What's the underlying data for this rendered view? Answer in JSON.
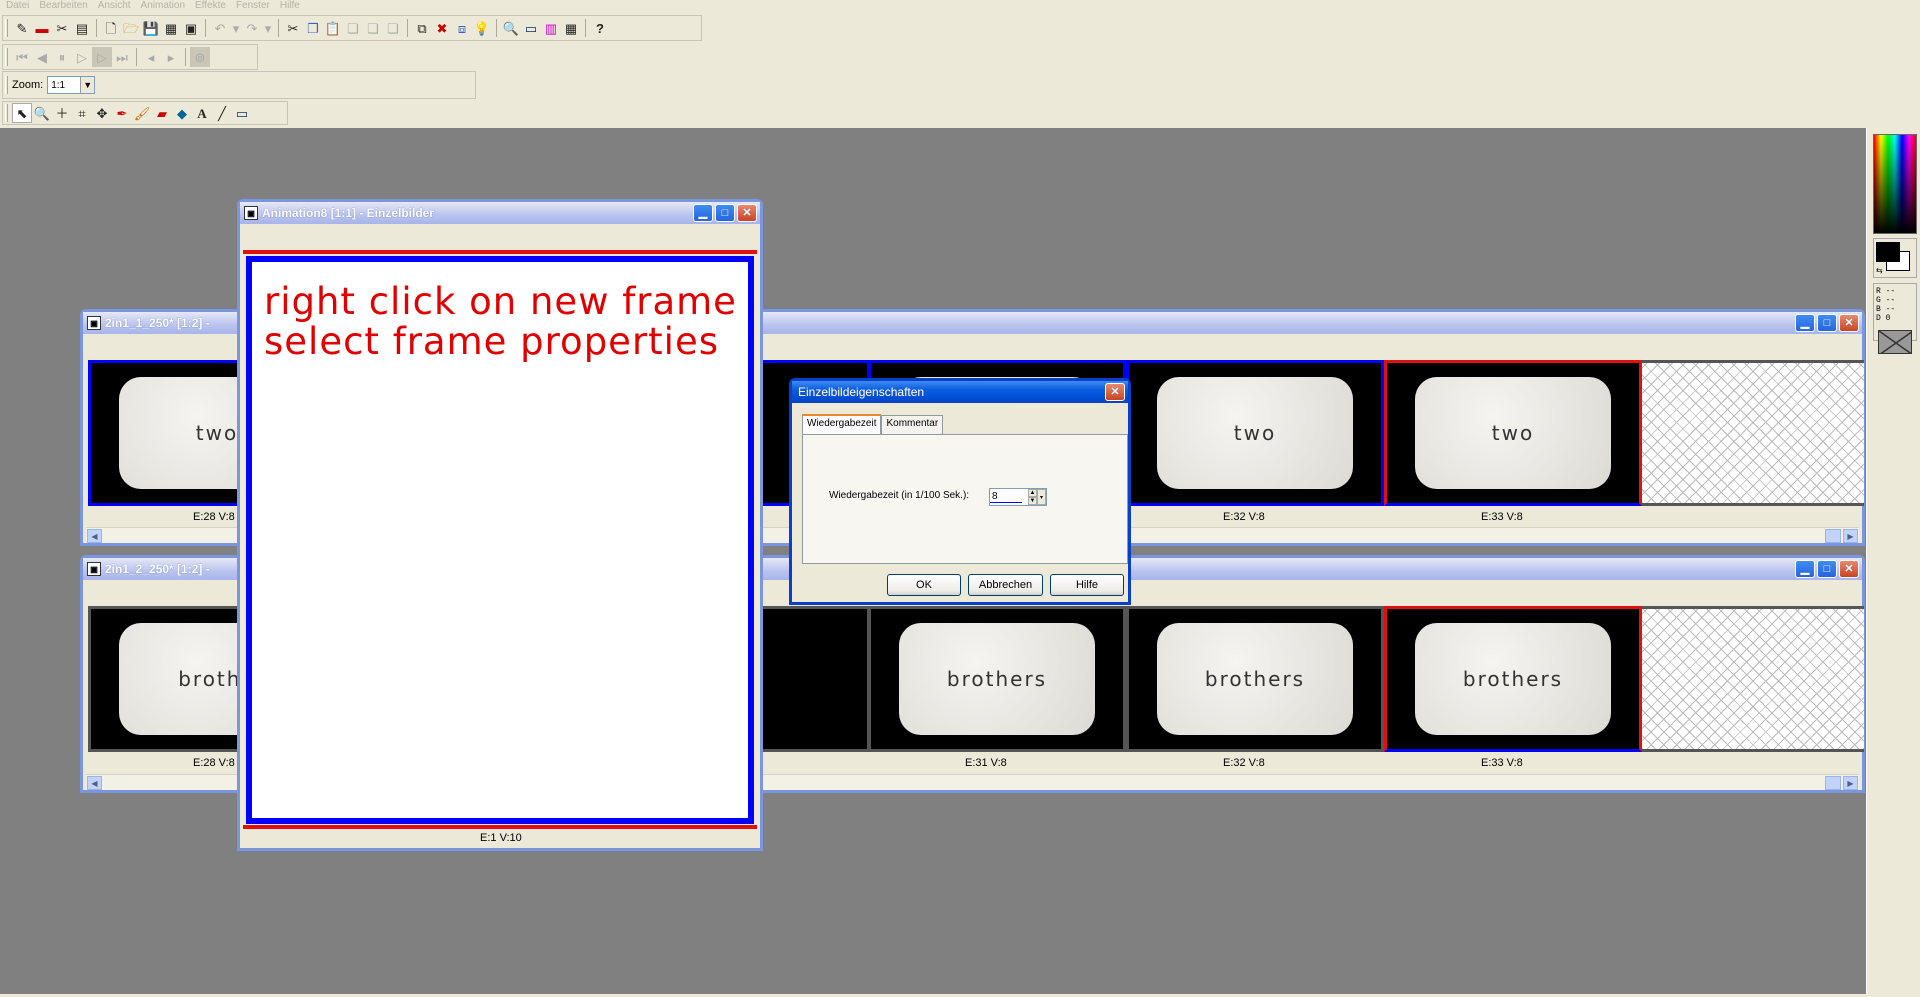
{
  "menu": [
    "Datei",
    "Bearbeiten",
    "Ansicht",
    "Animation",
    "Effekte",
    "Fenster",
    "Hilfe"
  ],
  "toolbar": {
    "zoom_label": "Zoom:",
    "zoom_value": "1:1",
    "text_tool_glyph": "A"
  },
  "window_frames": {
    "title": "Animation8 [1:1] - Einzelbilder",
    "instruction_line1": "right click on new frame",
    "instruction_line2": "select frame properties",
    "frame_label": "E:1   V:10",
    "frame_border_color": "#0000ff",
    "text_color": "#e00000"
  },
  "window_strip1": {
    "title": "2in1_1_250* [1:2] -",
    "card_text": "two",
    "labels": [
      "E:28   V:8",
      "E:32   V:8",
      "E:33   V:8"
    ]
  },
  "window_strip2": {
    "title": "2in1_2_250* [1:2] -",
    "card_text_partial": "brothe",
    "card_text_edge": "s",
    "card_text": "brothers",
    "labels": [
      "E:28   V:8",
      "E:31   V:8",
      "E:32   V:8",
      "E:33   V:8"
    ]
  },
  "dialog": {
    "title": "Einzelbildeigenschaften",
    "tab_playback": "Wiedergabezeit",
    "tab_comment": "Kommentar",
    "field_label": "Wiedergabezeit (in 1/100 Sek.):",
    "field_value": "8",
    "ok_label": "OK",
    "cancel_label": "Abbrechen",
    "help_label": "Hilfe"
  },
  "palette": {
    "r_label": "R --",
    "g_label": "G --",
    "b_label": "B --",
    "d_label": "D 0"
  },
  "colors": {
    "accent_blue": "#0a5ddf",
    "selected_frame": "#0000ff",
    "current_frame": "#e01010"
  }
}
